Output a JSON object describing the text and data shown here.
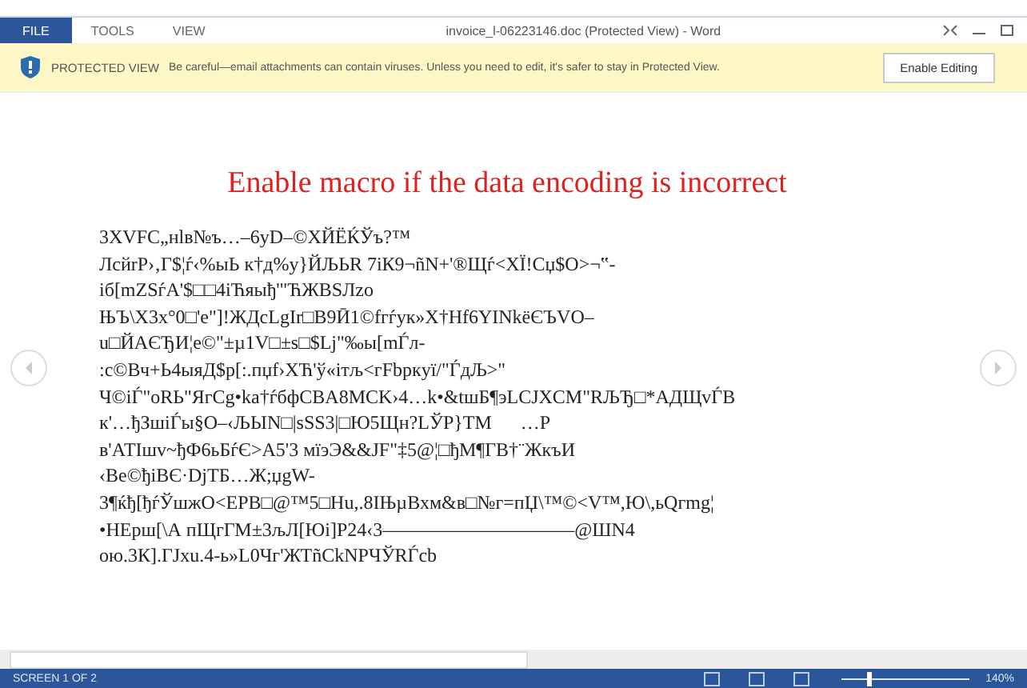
{
  "menu": {
    "tabs": [
      {
        "label": "FILE",
        "selected": true
      },
      {
        "label": "TOOLS",
        "selected": false
      },
      {
        "label": "VIEW",
        "selected": false
      }
    ]
  },
  "window": {
    "title": "invoice_l-06223146.doc (Protected View) - Word"
  },
  "protected_bar": {
    "label": "PROTECTED VIEW",
    "message": "Be careful—email attachments can contain viruses. Unless you need to edit, it's safer to stay in Protected View.",
    "button": "Enable Editing"
  },
  "document": {
    "heading": "Enable macro if the data encoding is incorrect",
    "lines": [
      "3XVFC„нlв№ъ…–6yD–©XЙЁЌЎъ?™",
      "ЛсйrР›‚Г$¦ѓ‹%ыЬ к†д%у}ЙЉЬR 7iК9¬ñN+'®Щѓ<XЇ!Сџ$О>¬‟-",
      "iб[mZSѓА'$□□4iЋяыђ'\"ЋЖBSЛzо",
      "ЊЪ\\X3x°0□'е\"]!ЖДсLgIr□B9Ӣ1©fгѓук»X†Hf6YINkёЄЪVO–",
      "u□ЙАЄЂИ¦е©\"±µ1V□±s□$Lj\"‰ы[mЃл-",
      ":с©Вч+Ь4ыяД$р[:.пџf›XЋ'ў«ітљ<гFbpкyї/\"ЃдЉ>\"",
      "Ч©іЃ\"оRЬ\"ЯгCg•ka†ѓбфCBA8MCK›4…k•&tшБ¶эLCJXCM\"RЉЂ□*АДЩvЃB",
      "к'…ђЗшіЃы§О–‹ЉЫN□|sSS3|□Ю5Щн?LЎР}TM      …P",
      "в'АТІшv~ђФ6ьБѓЄ>A5'3 мїэЭ&&JF\"‡5@¦□ђМ¶ГВ†¨ЖкъИ",
      "‹Ве©ђіВЄ·DjТБ…Ж;џgW-",
      "3¶ќђ[ђѓЎшжО<EPB□@™5□Hu,.8IЊµВхм&в□№г=пЏ\\™©<V™,Ю\\,ьQгmg¦",
      "•НЕрш[\\А пЩгГМ±3љЛ[Юі]Р24‹3——————————@ШN4",
      "ою.3К].ГЈхu.4-ь»L0Чг'ЖТñСkNPЧЎRЃсb"
    ]
  },
  "status_bar": {
    "page": "SCREEN 1 OF 2",
    "zoom": {
      "level": 0.2,
      "reading": "140%"
    }
  }
}
